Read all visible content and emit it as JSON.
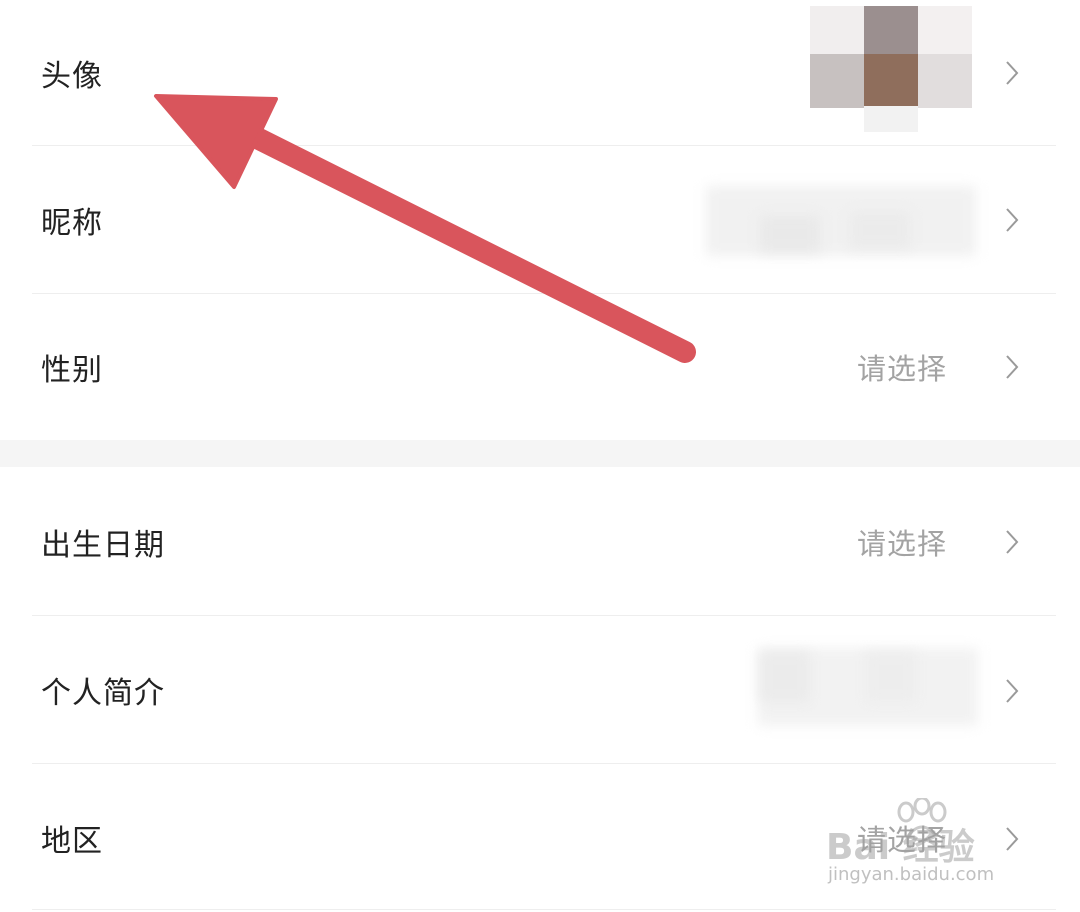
{
  "profile": {
    "rows": [
      {
        "label": "头像"
      },
      {
        "label": "昵称"
      },
      {
        "label": "性别",
        "value": "请选择"
      },
      {
        "label": "出生日期",
        "value": "请选择"
      },
      {
        "label": "个人简介"
      },
      {
        "label": "地区",
        "value": "请选择"
      }
    ]
  },
  "colors": {
    "arrow": "#d9555c",
    "label": "#222222",
    "value": "#a3a3a3",
    "divider": "#eeeeee",
    "section_gap": "#f5f5f5"
  },
  "icons": {
    "chevron": "chevron-right-icon",
    "annotation": "red-arrow-annotation"
  },
  "watermark": {
    "brand": "Bai 经验",
    "url": "jingyan.baidu.com"
  }
}
